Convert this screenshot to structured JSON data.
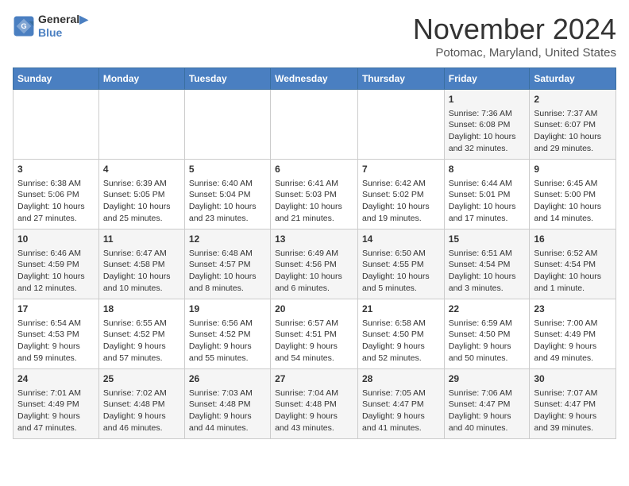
{
  "logo": {
    "line1": "General",
    "line2": "Blue"
  },
  "title": "November 2024",
  "location": "Potomac, Maryland, United States",
  "days_of_week": [
    "Sunday",
    "Monday",
    "Tuesday",
    "Wednesday",
    "Thursday",
    "Friday",
    "Saturday"
  ],
  "weeks": [
    [
      {
        "day": "",
        "info": ""
      },
      {
        "day": "",
        "info": ""
      },
      {
        "day": "",
        "info": ""
      },
      {
        "day": "",
        "info": ""
      },
      {
        "day": "",
        "info": ""
      },
      {
        "day": "1",
        "info": "Sunrise: 7:36 AM\nSunset: 6:08 PM\nDaylight: 10 hours\nand 32 minutes."
      },
      {
        "day": "2",
        "info": "Sunrise: 7:37 AM\nSunset: 6:07 PM\nDaylight: 10 hours\nand 29 minutes."
      }
    ],
    [
      {
        "day": "3",
        "info": "Sunrise: 6:38 AM\nSunset: 5:06 PM\nDaylight: 10 hours\nand 27 minutes."
      },
      {
        "day": "4",
        "info": "Sunrise: 6:39 AM\nSunset: 5:05 PM\nDaylight: 10 hours\nand 25 minutes."
      },
      {
        "day": "5",
        "info": "Sunrise: 6:40 AM\nSunset: 5:04 PM\nDaylight: 10 hours\nand 23 minutes."
      },
      {
        "day": "6",
        "info": "Sunrise: 6:41 AM\nSunset: 5:03 PM\nDaylight: 10 hours\nand 21 minutes."
      },
      {
        "day": "7",
        "info": "Sunrise: 6:42 AM\nSunset: 5:02 PM\nDaylight: 10 hours\nand 19 minutes."
      },
      {
        "day": "8",
        "info": "Sunrise: 6:44 AM\nSunset: 5:01 PM\nDaylight: 10 hours\nand 17 minutes."
      },
      {
        "day": "9",
        "info": "Sunrise: 6:45 AM\nSunset: 5:00 PM\nDaylight: 10 hours\nand 14 minutes."
      }
    ],
    [
      {
        "day": "10",
        "info": "Sunrise: 6:46 AM\nSunset: 4:59 PM\nDaylight: 10 hours\nand 12 minutes."
      },
      {
        "day": "11",
        "info": "Sunrise: 6:47 AM\nSunset: 4:58 PM\nDaylight: 10 hours\nand 10 minutes."
      },
      {
        "day": "12",
        "info": "Sunrise: 6:48 AM\nSunset: 4:57 PM\nDaylight: 10 hours\nand 8 minutes."
      },
      {
        "day": "13",
        "info": "Sunrise: 6:49 AM\nSunset: 4:56 PM\nDaylight: 10 hours\nand 6 minutes."
      },
      {
        "day": "14",
        "info": "Sunrise: 6:50 AM\nSunset: 4:55 PM\nDaylight: 10 hours\nand 5 minutes."
      },
      {
        "day": "15",
        "info": "Sunrise: 6:51 AM\nSunset: 4:54 PM\nDaylight: 10 hours\nand 3 minutes."
      },
      {
        "day": "16",
        "info": "Sunrise: 6:52 AM\nSunset: 4:54 PM\nDaylight: 10 hours\nand 1 minute."
      }
    ],
    [
      {
        "day": "17",
        "info": "Sunrise: 6:54 AM\nSunset: 4:53 PM\nDaylight: 9 hours\nand 59 minutes."
      },
      {
        "day": "18",
        "info": "Sunrise: 6:55 AM\nSunset: 4:52 PM\nDaylight: 9 hours\nand 57 minutes."
      },
      {
        "day": "19",
        "info": "Sunrise: 6:56 AM\nSunset: 4:52 PM\nDaylight: 9 hours\nand 55 minutes."
      },
      {
        "day": "20",
        "info": "Sunrise: 6:57 AM\nSunset: 4:51 PM\nDaylight: 9 hours\nand 54 minutes."
      },
      {
        "day": "21",
        "info": "Sunrise: 6:58 AM\nSunset: 4:50 PM\nDaylight: 9 hours\nand 52 minutes."
      },
      {
        "day": "22",
        "info": "Sunrise: 6:59 AM\nSunset: 4:50 PM\nDaylight: 9 hours\nand 50 minutes."
      },
      {
        "day": "23",
        "info": "Sunrise: 7:00 AM\nSunset: 4:49 PM\nDaylight: 9 hours\nand 49 minutes."
      }
    ],
    [
      {
        "day": "24",
        "info": "Sunrise: 7:01 AM\nSunset: 4:49 PM\nDaylight: 9 hours\nand 47 minutes."
      },
      {
        "day": "25",
        "info": "Sunrise: 7:02 AM\nSunset: 4:48 PM\nDaylight: 9 hours\nand 46 minutes."
      },
      {
        "day": "26",
        "info": "Sunrise: 7:03 AM\nSunset: 4:48 PM\nDaylight: 9 hours\nand 44 minutes."
      },
      {
        "day": "27",
        "info": "Sunrise: 7:04 AM\nSunset: 4:48 PM\nDaylight: 9 hours\nand 43 minutes."
      },
      {
        "day": "28",
        "info": "Sunrise: 7:05 AM\nSunset: 4:47 PM\nDaylight: 9 hours\nand 41 minutes."
      },
      {
        "day": "29",
        "info": "Sunrise: 7:06 AM\nSunset: 4:47 PM\nDaylight: 9 hours\nand 40 minutes."
      },
      {
        "day": "30",
        "info": "Sunrise: 7:07 AM\nSunset: 4:47 PM\nDaylight: 9 hours\nand 39 minutes."
      }
    ]
  ]
}
